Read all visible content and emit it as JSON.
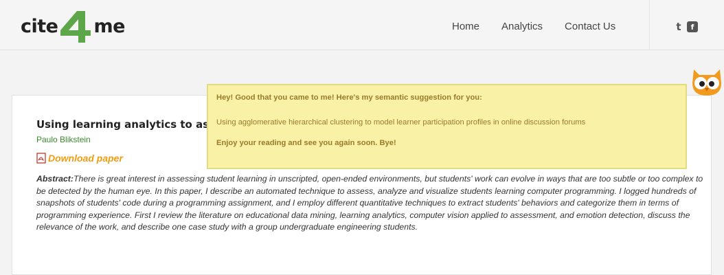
{
  "header": {
    "logo": {
      "left_text": "cite",
      "number": "4",
      "right_text": "me"
    },
    "nav": [
      "Home",
      "Analytics",
      "Contact Us"
    ],
    "social": {
      "twitter_glyph": "t",
      "facebook_glyph": "f"
    }
  },
  "paper": {
    "title": "Using learning analytics to asse",
    "author": "Paulo Blikstein",
    "download_label": "Download paper",
    "abstract_label": "Abstract:",
    "abstract_text": "There is great interest in assessing student learning in unscripted, open-ended environments, but students' work can evolve in ways that are too subtle or too complex to be detected by the human eye. In this paper, I describe an automated technique to assess, analyze and visualize students learning computer programming. I logged hundreds of snapshots of students' code during a programming assignment, and I employ different quantitative techniques to extract students' behaviors and categorize them in terms of programming experience. First I review the literature on educational data mining, learning analytics, computer vision applied to assessment, and emotion detection, discuss the relevance of the work, and describe one case study with a group undergraduate engineering students."
  },
  "suggestion": {
    "greeting": "Hey! Good that you came to me! Here's my semantic suggestion for you:",
    "suggested_title": "Using agglomerative hierarchical clustering to model learner participation profiles in online discussion forums",
    "closing": "Enjoy your reading and see you again soon. Bye!"
  },
  "colors": {
    "logo_green": "#5ea64a",
    "author_green": "#3a8a2c",
    "download_orange": "#f39c12",
    "tip_background": "#f9f2a6",
    "tip_text": "#9a7a2a",
    "owl_orange": "#f29a1f"
  },
  "icons": {
    "owl": "owl-mascot-icon",
    "pdf": "pdf-icon",
    "twitter": "twitter-icon",
    "facebook": "facebook-icon"
  }
}
